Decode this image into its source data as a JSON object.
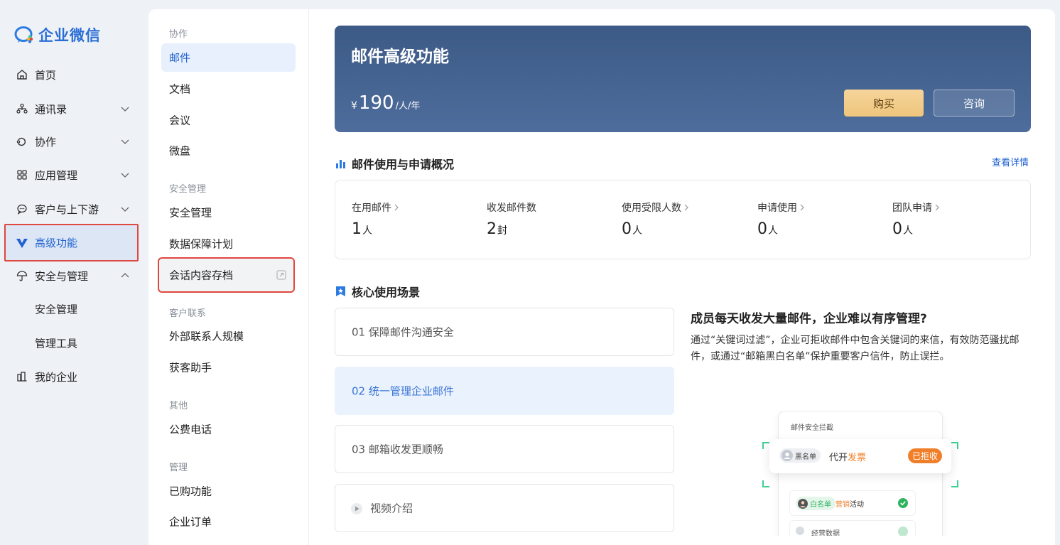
{
  "brand": {
    "name": "企业微信"
  },
  "nav": {
    "items": [
      {
        "label": "首页",
        "icon": "home-icon"
      },
      {
        "label": "通讯录",
        "icon": "contacts-icon"
      },
      {
        "label": "协作",
        "icon": "collab-icon"
      },
      {
        "label": "应用管理",
        "icon": "apps-icon"
      },
      {
        "label": "客户与上下游",
        "icon": "chat-icon"
      },
      {
        "label": "高级功能",
        "icon": "v-icon"
      },
      {
        "label": "安全与管理",
        "icon": "umbrella-icon"
      },
      {
        "label": "安全管理"
      },
      {
        "label": "管理工具"
      },
      {
        "label": "我的企业",
        "icon": "building-icon"
      }
    ]
  },
  "mid": {
    "groups": [
      "协作",
      "安全管理",
      "客户联系",
      "其他",
      "管理"
    ],
    "items": [
      "邮件",
      "文档",
      "会议",
      "微盘",
      "安全管理",
      "数据保障计划",
      "会话内容存档",
      "外部联系人规模",
      "获客助手",
      "公费电话",
      "已购功能",
      "企业订单"
    ]
  },
  "hero": {
    "title": "邮件高级功能",
    "currency": "¥",
    "price": "190",
    "unit": "/人/年",
    "buy": "购买",
    "consult": "咨询"
  },
  "overview": {
    "title": "邮件使用与申请概况",
    "detail_link": "查看详情",
    "stats": [
      {
        "label": "在用邮件",
        "value": "1",
        "unit": "人"
      },
      {
        "label": "收发邮件数",
        "value": "2",
        "unit": "封"
      },
      {
        "label": "使用受限人数",
        "value": "0",
        "unit": "人"
      },
      {
        "label": "申请使用",
        "value": "0",
        "unit": "人"
      },
      {
        "label": "团队申请",
        "value": "0",
        "unit": "人"
      }
    ]
  },
  "scenes": {
    "title": "核心使用场景",
    "items": [
      "01  保障邮件沟通安全",
      "02  统一管理企业邮件",
      "03  邮箱收发更顺畅",
      "视频介绍"
    ],
    "desc_title": "成员每天收发大量邮件，企业难以有序管理?",
    "desc_body": "通过“关键词过滤”，企业可拒收邮件中包含关键词的来信，有效防范骚扰邮件，或通过“邮箱黑白名单”保护重要客户信件，防止误拦。"
  },
  "illustration": {
    "card_title": "邮件安全拦截",
    "black_tag": "黑名单",
    "row1_prefix": "代开",
    "row1_highlight": "发票",
    "rejected": "已拒收",
    "white_tag": "白名单",
    "row2_highlight": "营销",
    "row2_suffix": "活动",
    "row3_text": "经营数据"
  },
  "colors": {
    "accent": "#2163d1",
    "highlight_red": "#e0473f",
    "hero_bg": "#465f8c",
    "buy_gold": "#f2cb85",
    "orange": "#f07f2a",
    "green": "#2fb35f"
  }
}
